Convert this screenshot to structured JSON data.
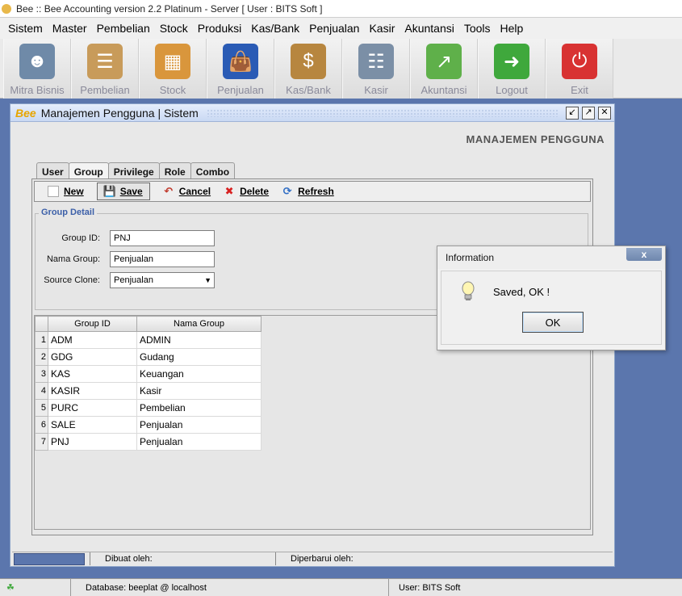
{
  "window": {
    "title": "Bee :: Bee Accounting version 2.2 Platinum - Server  [ User : BITS Soft ]"
  },
  "menu": [
    "Sistem",
    "Master",
    "Pembelian",
    "Stock",
    "Produksi",
    "Kas/Bank",
    "Penjualan",
    "Kasir",
    "Akuntansi",
    "Tools",
    "Help"
  ],
  "toolbar": [
    {
      "label": "Mitra Bisnis",
      "icon": "partners-icon",
      "color": "#6f8aa8"
    },
    {
      "label": "Pembelian",
      "icon": "purchase-icon",
      "color": "#c89b5a"
    },
    {
      "label": "Stock",
      "icon": "boxes-icon",
      "color": "#d9963c"
    },
    {
      "label": "Penjualan",
      "icon": "shopping-bag-icon",
      "color": "#2a5bb5"
    },
    {
      "label": "Kas/Bank",
      "icon": "money-bag-icon",
      "color": "#b7863f"
    },
    {
      "label": "Kasir",
      "icon": "cart-icon",
      "color": "#7b8fa6"
    },
    {
      "label": "Akuntansi",
      "icon": "chart-up-icon",
      "color": "#5fb04a"
    },
    {
      "label": "Logout",
      "icon": "logout-icon",
      "color": "#3fa83c"
    },
    {
      "label": "Exit",
      "icon": "power-icon",
      "color": "#d83232"
    }
  ],
  "frame": {
    "logo": "Bee",
    "title": "Manajemen Pengguna | Sistem",
    "heading": "MANAJEMEN PENGGUNA"
  },
  "tabs": [
    "User",
    "Group",
    "Privilege",
    "Role",
    "Combo"
  ],
  "active_tab": "Group",
  "actions": {
    "new": "New",
    "save": "Save",
    "cancel": "Cancel",
    "delete": "Delete",
    "refresh": "Refresh"
  },
  "detail": {
    "legend": "Group Detail",
    "group_id_label": "Group ID:",
    "group_id_value": "PNJ",
    "nama_group_label": "Nama Group:",
    "nama_group_value": "Penjualan",
    "source_clone_label": "Source Clone:",
    "source_clone_value": "Penjualan"
  },
  "table": {
    "columns": [
      "Group ID",
      "Nama Group"
    ],
    "rows": [
      [
        "1",
        "ADM",
        "ADMIN"
      ],
      [
        "2",
        "GDG",
        "Gudang"
      ],
      [
        "3",
        "KAS",
        "Keuangan"
      ],
      [
        "4",
        "KASIR",
        "Kasir"
      ],
      [
        "5",
        "PURC",
        "Pembelian"
      ],
      [
        "6",
        "SALE",
        "Penjualan"
      ],
      [
        "7",
        "PNJ",
        "Penjualan"
      ]
    ]
  },
  "frame_status": {
    "created": "Dibuat oleh:",
    "updated": "Diperbarui oleh:"
  },
  "status": {
    "database": "Database: beeplat @ localhost",
    "user": "User: BITS Soft"
  },
  "dialog": {
    "title": "Information",
    "close": "x",
    "message": "Saved, OK !",
    "ok": "OK"
  }
}
